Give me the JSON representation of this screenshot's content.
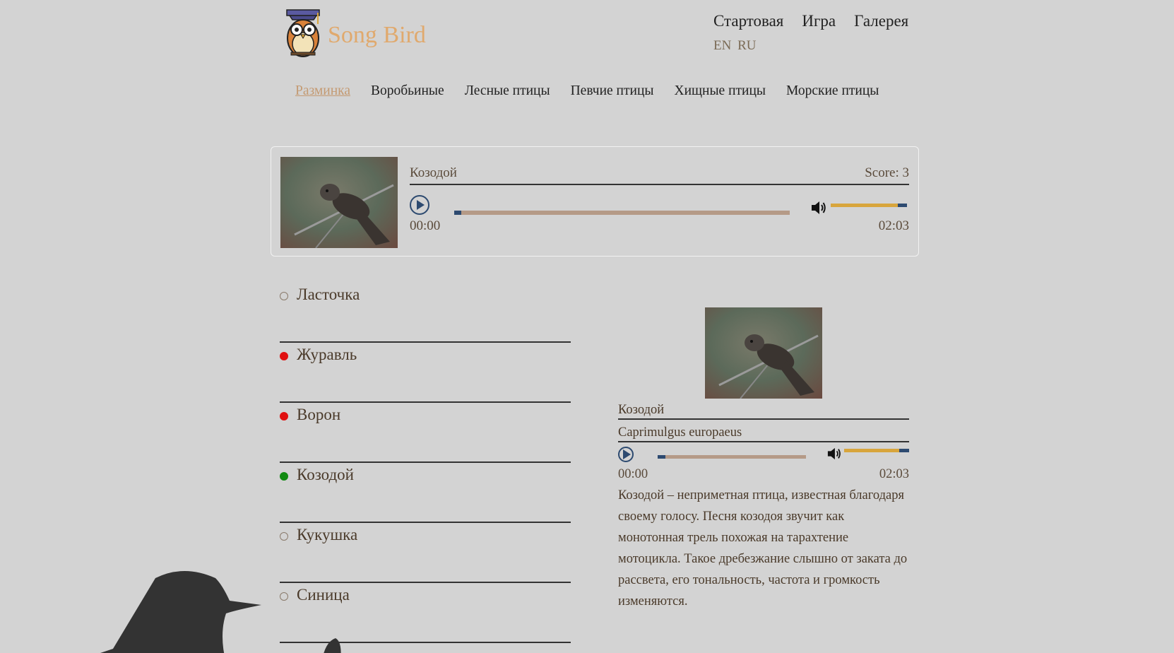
{
  "brand": {
    "title": "Song Bird",
    "logo_icon": "owl-graduate-icon"
  },
  "top_nav": [
    "Стартовая",
    "Игра",
    "Галерея"
  ],
  "lang": [
    "EN",
    "RU"
  ],
  "categories": {
    "active": "Разминка",
    "items": [
      "Воробьиные",
      "Лесные птицы",
      "Певчие птицы",
      "Хищные птицы",
      "Морские птицы"
    ]
  },
  "question": {
    "bird_name": "Козодой",
    "score_label": "Score: 3",
    "player": {
      "current": "00:00",
      "duration": "02:03",
      "progress": 0.02,
      "volume": 0.88
    }
  },
  "answers": [
    {
      "label": "Ласточка",
      "state": "none"
    },
    {
      "label": "Журавль",
      "state": "wrong"
    },
    {
      "label": "Ворон",
      "state": "wrong"
    },
    {
      "label": "Козодой",
      "state": "right"
    },
    {
      "label": "Кукушка",
      "state": "none"
    },
    {
      "label": "Синица",
      "state": "none"
    }
  ],
  "info": {
    "name": "Козодой",
    "latin": "Caprimulgus europaeus",
    "player": {
      "current": "00:00",
      "duration": "02:03",
      "progress": 0.05,
      "volume": 0.85
    },
    "description": "Козодой – неприметная птица, известная благодаря своему голосу. Песня козодоя звучит как монотонная трель похожая на тарахтение мотоцикла. Такое дребезжание слышно от заката до рассвета, его тональность, частота и громкость изменяются."
  },
  "colors": {
    "accent": "#e0a96d",
    "progress": "#b59a87",
    "volume": "#d8a53c",
    "dark_blue": "#2d4a70",
    "wrong": "#e01010",
    "right": "#118a11"
  }
}
